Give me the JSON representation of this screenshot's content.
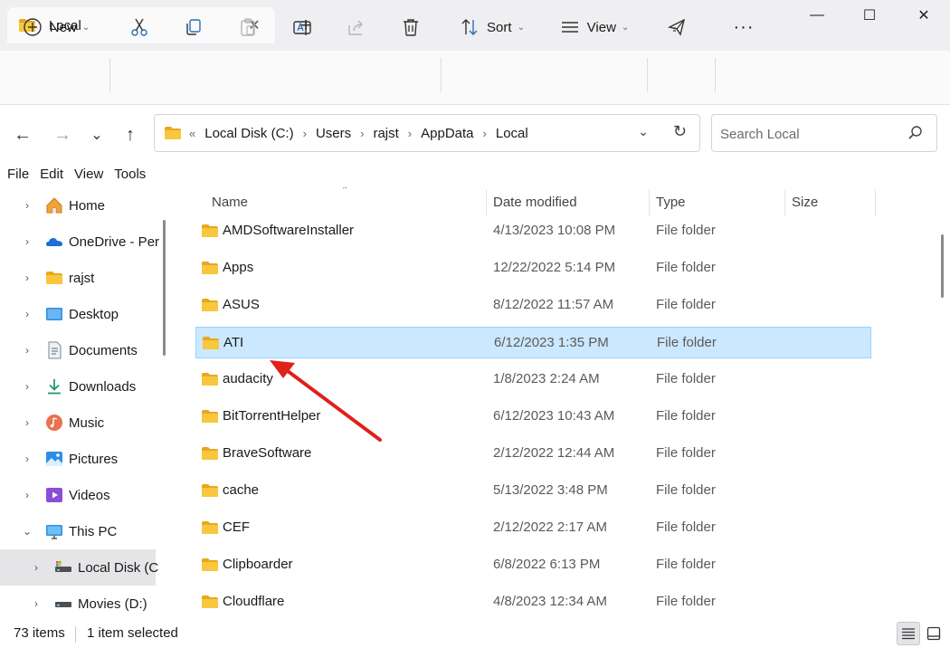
{
  "window": {
    "tab_title": "Local",
    "tab_close_glyph": "✕",
    "new_tab_glyph": "+",
    "minimize_glyph": "—",
    "maximize_glyph": "☐",
    "close_glyph": "✕"
  },
  "toolbar": {
    "new_label": "New",
    "sort_label": "Sort",
    "view_label": "View",
    "more_glyph": "···",
    "icons": [
      "new-icon",
      "cut-icon",
      "copy-icon",
      "paste-icon",
      "rename-icon",
      "share-icon",
      "delete-icon",
      "sort-icon",
      "view-icon",
      "filter-icon",
      "more-icon"
    ]
  },
  "nav": {
    "back_glyph": "←",
    "forward_glyph": "→",
    "recent_glyph": "⌄",
    "up_glyph": "↑"
  },
  "address": {
    "overflow": "«",
    "crumbs": [
      "Local Disk (C:)",
      "Users",
      "rajst",
      "AppData",
      "Local"
    ],
    "separator": "›",
    "dropdown_glyph": "⌄",
    "refresh_glyph": "↻"
  },
  "search": {
    "placeholder": "Search Local"
  },
  "menu": [
    "File",
    "Edit",
    "View",
    "Tools"
  ],
  "sidebar": {
    "items": [
      {
        "label": "Home",
        "chev": "›",
        "icon": "home-icon"
      },
      {
        "label": "OneDrive - Per",
        "chev": "›",
        "icon": "onedrive-icon"
      },
      {
        "label": "rajst",
        "chev": "›",
        "icon": "folder-icon"
      },
      {
        "label": "Desktop",
        "chev": "›",
        "icon": "desktop-icon"
      },
      {
        "label": "Documents",
        "chev": "›",
        "icon": "documents-icon"
      },
      {
        "label": "Downloads",
        "chev": "›",
        "icon": "downloads-icon"
      },
      {
        "label": "Music",
        "chev": "›",
        "icon": "music-icon"
      },
      {
        "label": "Pictures",
        "chev": "›",
        "icon": "pictures-icon"
      },
      {
        "label": "Videos",
        "chev": "›",
        "icon": "videos-icon"
      },
      {
        "label": "This PC",
        "chev": "⌄",
        "icon": "pc-icon"
      },
      {
        "label": "Local Disk (C",
        "chev": "›",
        "icon": "drive-icon"
      },
      {
        "label": "Movies (D:)",
        "chev": "›",
        "icon": "drive-icon"
      }
    ]
  },
  "columns": {
    "name": "Name",
    "date": "Date modified",
    "type": "Type",
    "size": "Size",
    "sort_glyph": "⌃"
  },
  "files": [
    {
      "name": "AMDSoftwareInstaller",
      "date": "4/13/2023 10:08 PM",
      "type": "File folder"
    },
    {
      "name": "Apps",
      "date": "12/22/2022 5:14 PM",
      "type": "File folder"
    },
    {
      "name": "ASUS",
      "date": "8/12/2022 11:57 AM",
      "type": "File folder"
    },
    {
      "name": "ATI",
      "date": "6/12/2023 1:35 PM",
      "type": "File folder",
      "selected": true
    },
    {
      "name": "audacity",
      "date": "1/8/2023 2:24 AM",
      "type": "File folder"
    },
    {
      "name": "BitTorrentHelper",
      "date": "6/12/2023 10:43 AM",
      "type": "File folder"
    },
    {
      "name": "BraveSoftware",
      "date": "2/12/2022 12:44 AM",
      "type": "File folder"
    },
    {
      "name": "cache",
      "date": "5/13/2022 3:48 PM",
      "type": "File folder"
    },
    {
      "name": "CEF",
      "date": "2/12/2022 2:17 AM",
      "type": "File folder"
    },
    {
      "name": "Clipboarder",
      "date": "6/8/2022 6:13 PM",
      "type": "File folder"
    },
    {
      "name": "Cloudflare",
      "date": "4/8/2023 12:34 AM",
      "type": "File folder"
    }
  ],
  "status": {
    "items_count": "73 items",
    "selected_count": "1 item selected"
  },
  "colors": {
    "selection_bg": "#cce8ff",
    "selection_border": "#99d1ff",
    "folder_yellow": "#f8c73e",
    "annotation_arrow": "#e0201b",
    "titlebar_bg": "#efeef1"
  }
}
